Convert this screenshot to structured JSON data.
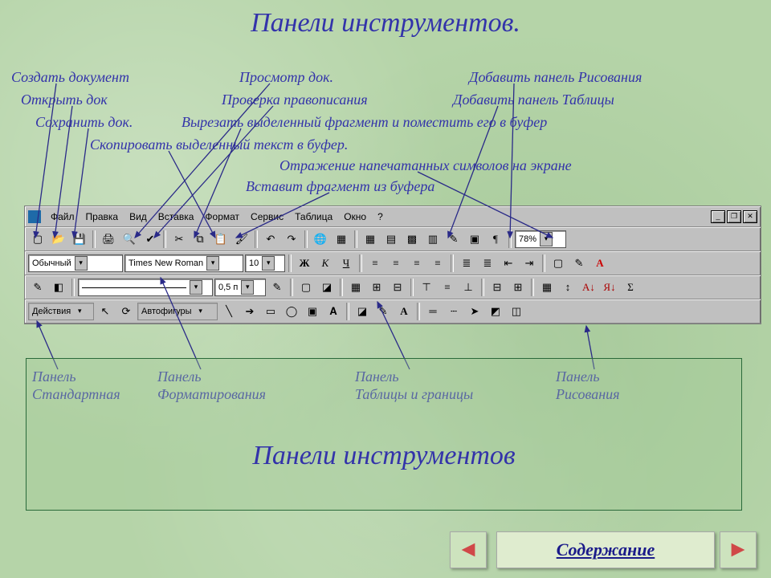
{
  "title": "Панели инструментов.",
  "labels": {
    "l1": "Создать документ",
    "l2": "Открыть док",
    "l3": "Сохранить док.",
    "l4": "Скопировать выделенный текст в буфер.",
    "l5": "Просмотр док.",
    "l6": "Проверка правописания",
    "l7": "Вырезать выделенный фрагмент и поместить его в буфер",
    "l8": "Вставит фрагмент из буфера",
    "l9": "Добавить панель Рисования",
    "l10": "Добавить панель Таблицы",
    "l11": "Отражение напечатанных символов на экране"
  },
  "menu": {
    "m1": "Файл",
    "m2": "Правка",
    "m3": "Вид",
    "m4": "Вставка",
    "m5": "Формат",
    "m6": "Сервис",
    "m7": "Таблица",
    "m8": "Окно",
    "m9": "?"
  },
  "fmt": {
    "style": "Обычный",
    "font": "Times New Roman",
    "size": "10",
    "zoom": "78%",
    "pt": "0,5 п"
  },
  "btns": {
    "bold": "Ж",
    "italic": "К",
    "underline": "Ч",
    "actions": "Действия",
    "autoshapes": "Автофигуры"
  },
  "panels": {
    "p1a": "Панель",
    "p1b": "Стандартная",
    "p2a": "Панель",
    "p2b": "Форматирования",
    "p3a": "Панель",
    "p3b": "Таблицы и границы",
    "p4a": "Панель",
    "p4b": "Рисования"
  },
  "bigtitle": "Панели инструментов",
  "nav": {
    "prev": "◄",
    "next": "►",
    "contents": "Содержание"
  }
}
